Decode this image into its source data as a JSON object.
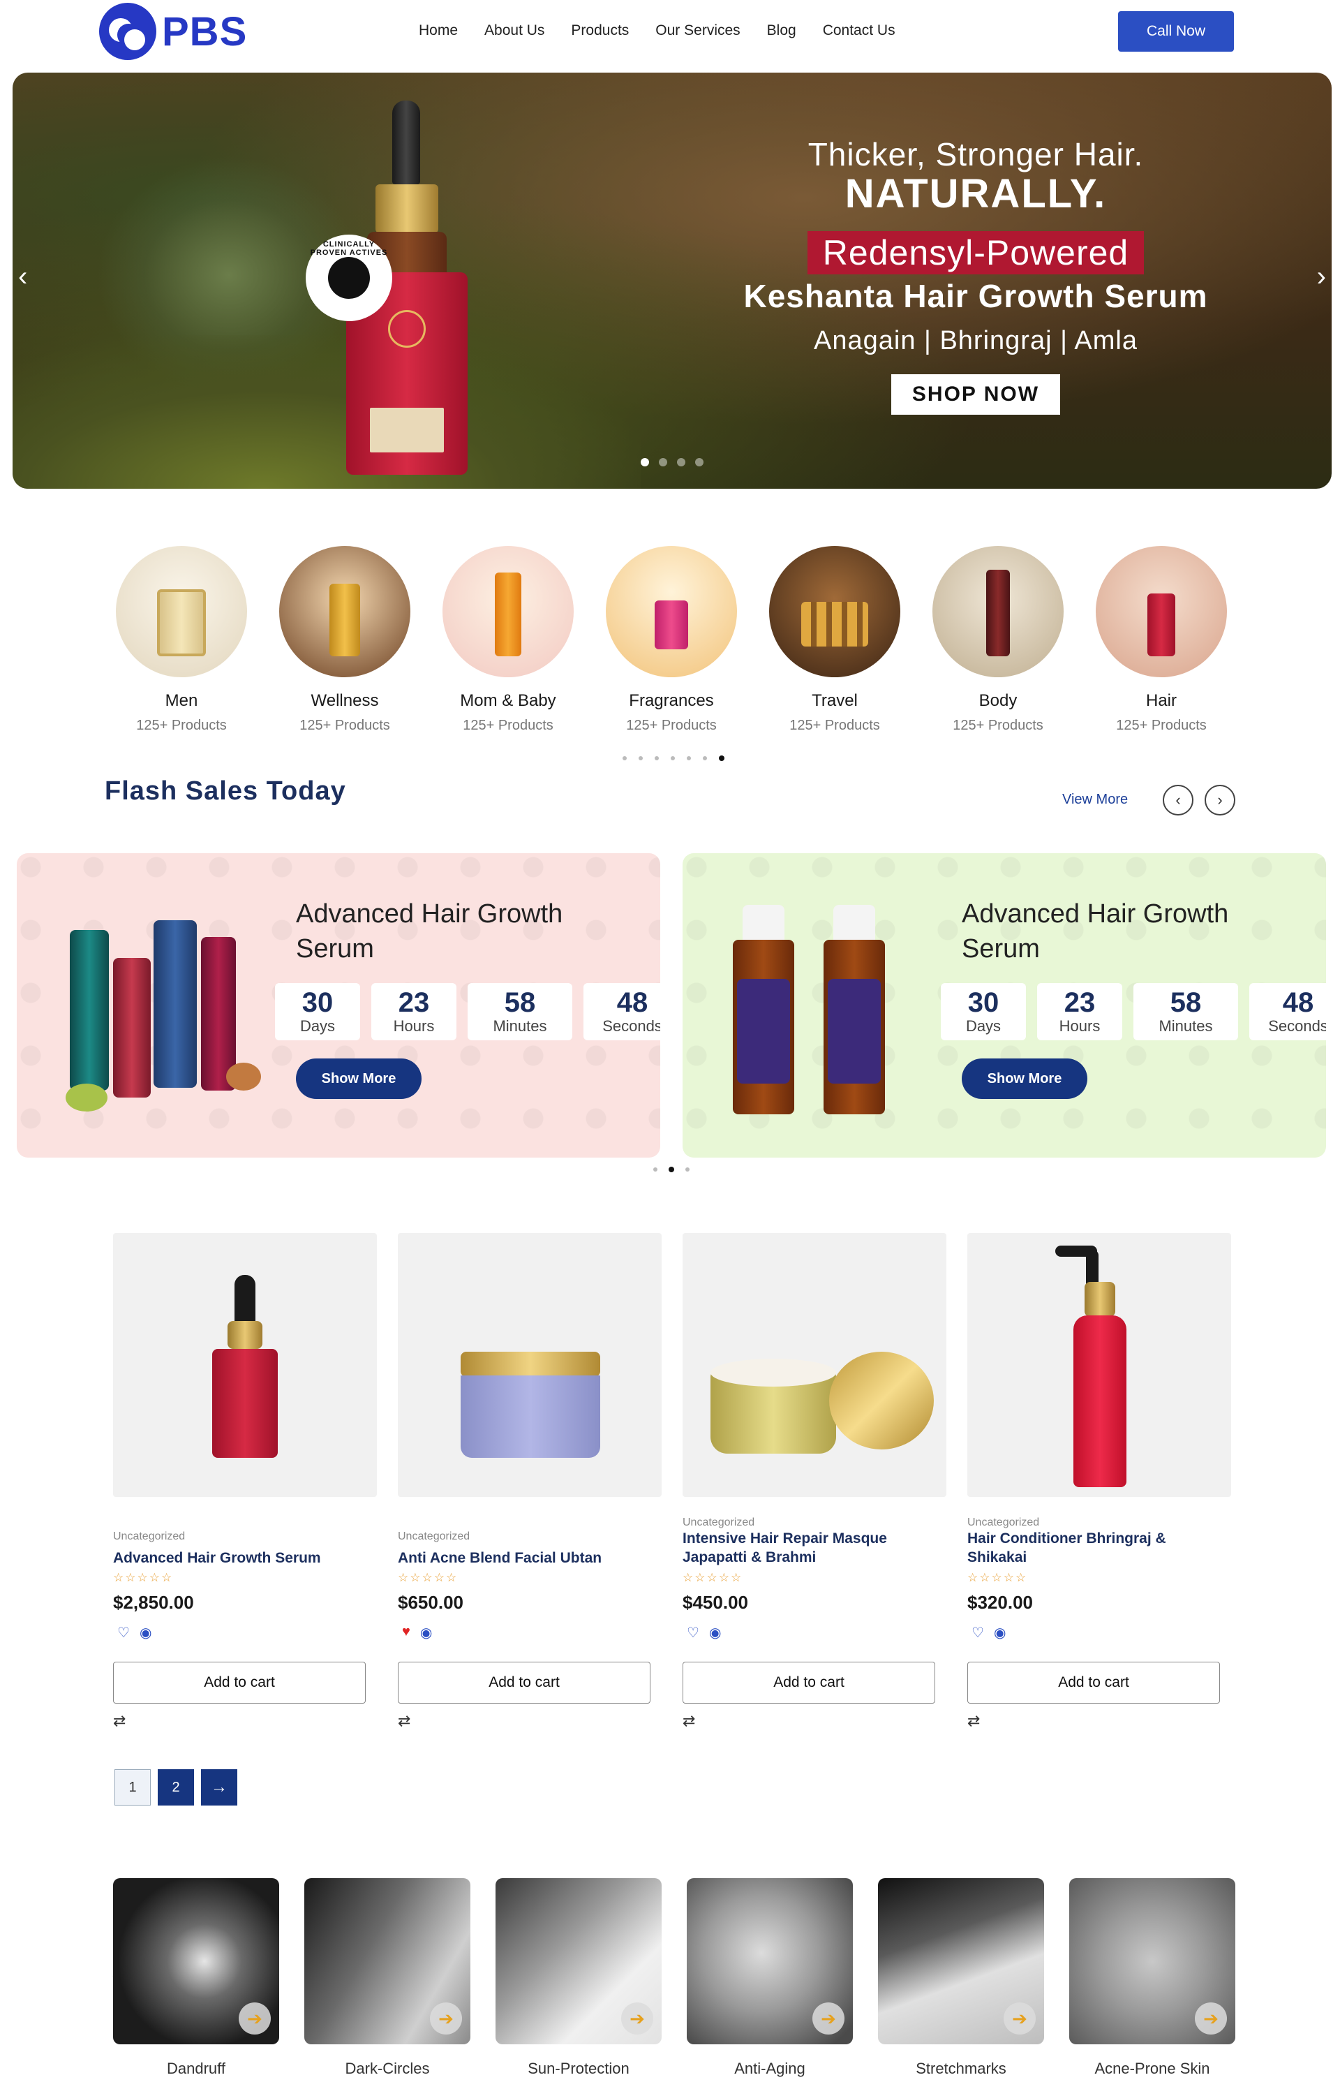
{
  "header": {
    "logo_text": "PBS",
    "nav": [
      "Home",
      "About Us",
      "Products",
      "Our Services",
      "Blog",
      "Contact Us"
    ],
    "call_label": "Call Now"
  },
  "hero": {
    "line1": "Thicker, Stronger Hair.",
    "line2": "NATURALLY.",
    "line3": "Redensyl-Powered",
    "line4": "Keshanta Hair Growth Serum",
    "line5": "Anagain | Bhringraj | Amla",
    "cta": "SHOP NOW",
    "badge_text": "CLINICALLY PROVEN ACTIVES",
    "prev_arrow": "‹",
    "next_arrow": "›"
  },
  "categories": [
    {
      "name": "Men",
      "count": "125+ Products"
    },
    {
      "name": "Wellness",
      "count": "125+ Products"
    },
    {
      "name": "Mom & Baby",
      "count": "125+ Products"
    },
    {
      "name": "Fragrances",
      "count": "125+ Products"
    },
    {
      "name": "Travel",
      "count": "125+ Products"
    },
    {
      "name": "Body",
      "count": "125+ Products"
    },
    {
      "name": "Hair",
      "count": "125+ Products"
    }
  ],
  "flash": {
    "title": "Flash Sales Today",
    "view_more": "View More",
    "prev": "‹",
    "next": "›"
  },
  "promos": [
    {
      "title": "Advanced Hair Growth Serum",
      "timer": [
        {
          "num": "30",
          "label": "Days"
        },
        {
          "num": "23",
          "label": "Hours"
        },
        {
          "num": "58",
          "label": "Minutes"
        },
        {
          "num": "48",
          "label": "Seconds"
        }
      ],
      "cta": "Show More"
    },
    {
      "title": "Advanced Hair Growth Serum",
      "timer": [
        {
          "num": "30",
          "label": "Days"
        },
        {
          "num": "23",
          "label": "Hours"
        },
        {
          "num": "58",
          "label": "Minutes"
        },
        {
          "num": "48",
          "label": "Seconds"
        }
      ],
      "cta": "Show More"
    }
  ],
  "products": [
    {
      "category": "Uncategorized",
      "title": "Advanced Hair Growth Serum",
      "stars": "☆☆☆☆☆",
      "price": "$2,850.00",
      "cart": "Add to cart"
    },
    {
      "category": "Uncategorized",
      "title": "Anti Acne Blend Facial Ubtan",
      "stars": "☆☆☆☆☆",
      "price": "$650.00",
      "cart": "Add to cart"
    },
    {
      "category": "Uncategorized",
      "title": "Intensive Hair Repair Masque Japapatti & Brahmi",
      "stars": "☆☆☆☆☆",
      "price": "$450.00",
      "cart": "Add to cart"
    },
    {
      "category": "Uncategorized",
      "title": "Hair Conditioner Bhringraj & Shikakai",
      "stars": "☆☆☆☆☆",
      "price": "$320.00",
      "cart": "Add to cart"
    }
  ],
  "pagination": {
    "p1": "1",
    "p2": "2",
    "next": "→"
  },
  "concerns": [
    {
      "name": "Dandruff"
    },
    {
      "name": "Dark-Circles"
    },
    {
      "name": "Sun-Protection"
    },
    {
      "name": "Anti-Aging"
    },
    {
      "name": "Stretchmarks"
    },
    {
      "name": "Acne-Prone Skin"
    }
  ],
  "colors": {
    "brand_blue": "#2638c4",
    "navy": "#163580",
    "hero_red": "#b01831",
    "star_orange": "#e8a036"
  }
}
